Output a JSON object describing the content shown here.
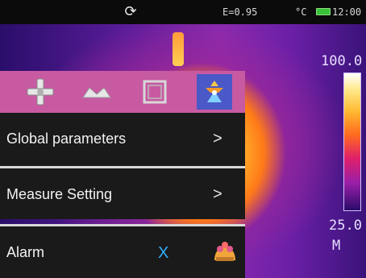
{
  "status": {
    "emissivity": "E=0.95",
    "unit": "°C",
    "time": "12:00",
    "icons": [
      "refresh-icon",
      "battery-icon"
    ]
  },
  "scale": {
    "max": "100.0",
    "min": "25.0",
    "mode": "M"
  },
  "toolbar": {
    "tools": [
      "crosshair-icon",
      "wave-icon",
      "frame-icon",
      "settings-icon"
    ],
    "selected": 3
  },
  "menu": {
    "items": [
      {
        "label": "Global parameters",
        "arrow": ">"
      },
      {
        "label": "Measure Setting",
        "arrow": ">"
      },
      {
        "label": "Alarm",
        "value": "X",
        "icon": "alarm-icon"
      }
    ]
  },
  "colors": {
    "toolbar": "#c85aa2",
    "selected_tool": "#4a58c8",
    "menu_bg": "#1a1a1a",
    "alarm_x": "#2fb0ff"
  }
}
